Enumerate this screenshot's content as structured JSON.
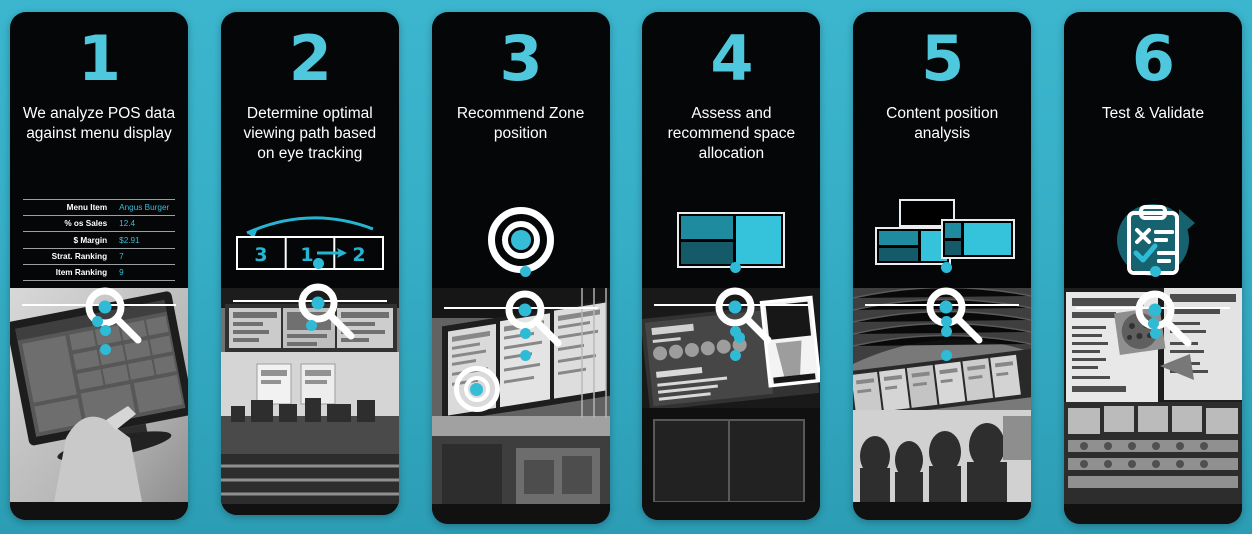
{
  "theme": {
    "background_teal": "#35AEC6",
    "card_black": "#050607",
    "accent_cyan": "#4FC7DC",
    "accent_cyan_bright": "#35C3DC",
    "accent_teal_mid": "#1E8C9E",
    "accent_teal_dark": "#145A68",
    "text_white": "#FFFFFF"
  },
  "steps": [
    {
      "number": "1",
      "title": "We analyze POS data against menu display",
      "graphic": "pos-data-table",
      "table": {
        "rows": [
          {
            "label": "Menu Item",
            "value": "Angus Burger"
          },
          {
            "label": "% os Sales",
            "value": "12.4"
          },
          {
            "label": "$ Margin",
            "value": "$2.91"
          },
          {
            "label": "Strat. Ranking",
            "value": "7"
          },
          {
            "label": "Item Ranking",
            "value": "9"
          }
        ]
      },
      "photo_caption": "hand using POS touchscreen terminal"
    },
    {
      "number": "2",
      "title": "Determine optimal viewing path based on eye tracking",
      "graphic": "eye-path-diagram",
      "path_cells": [
        "3",
        "1",
        "2"
      ],
      "photo_caption": "counter service area with overhead menu boards"
    },
    {
      "number": "3",
      "title": "Recommend Zone position",
      "graphic": "bullseye-target",
      "photo_caption": "outdoor drive-thru menu boards"
    },
    {
      "number": "4",
      "title": "Assess and recommend space allocation",
      "graphic": "space-allocation-blocks",
      "photo_caption": "digital beverage menu board"
    },
    {
      "number": "5",
      "title": "Content position analysis",
      "graphic": "content-position-blocks",
      "photo_caption": "customers queuing under menu boards"
    },
    {
      "number": "6",
      "title": "Test & Validate",
      "graphic": "clipboard-cycle-check",
      "photo_caption": "pizza shop menu boards and product shelves"
    }
  ],
  "icons": {
    "magnifier": "magnifier-icon",
    "bullseye": "bullseye-icon",
    "clipboard": "clipboard-icon",
    "cycle_arrow": "cycle-arrow-icon",
    "check": "check-icon",
    "cross": "cross-icon",
    "arrow_right": "arrow-right-icon",
    "arrow_curve": "curved-arrow-icon"
  }
}
